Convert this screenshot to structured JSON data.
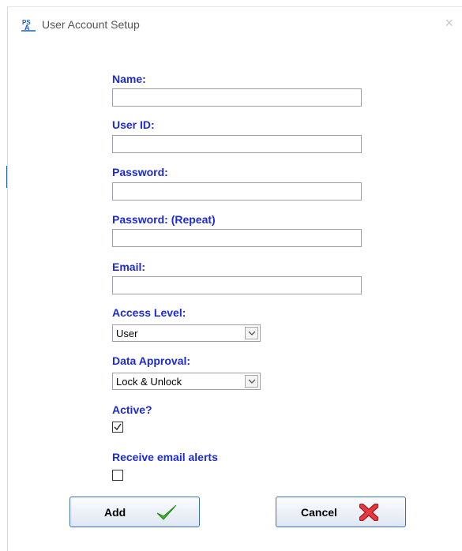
{
  "window": {
    "title": "User Account Setup",
    "close_glyph": "×"
  },
  "form": {
    "name_label": "Name:",
    "name_value": "",
    "userid_label": "User ID:",
    "userid_value": "",
    "password_label": "Password:",
    "password_value": "",
    "password_repeat_label": "Password: (Repeat)",
    "password_repeat_value": "",
    "email_label": "Email:",
    "email_value": "",
    "access_level_label": "Access Level:",
    "access_level_value": "User",
    "data_approval_label": "Data Approval:",
    "data_approval_value": "Lock & Unlock",
    "active_label": "Active?",
    "active_checked": true,
    "email_alerts_label": "Receive email alerts",
    "email_alerts_checked": false
  },
  "buttons": {
    "add_label": "Add",
    "cancel_label": "Cancel"
  },
  "icons": {
    "app": "psa-app-icon",
    "add": "green-checkmark-icon",
    "cancel": "red-x-icon",
    "dropdown": "chevron-down-icon"
  },
  "colors": {
    "label_blue": "#1c2bd6",
    "button_border": "#3c6fb3",
    "check_green": "#3fae2a",
    "cancel_red": "#d9262b"
  }
}
